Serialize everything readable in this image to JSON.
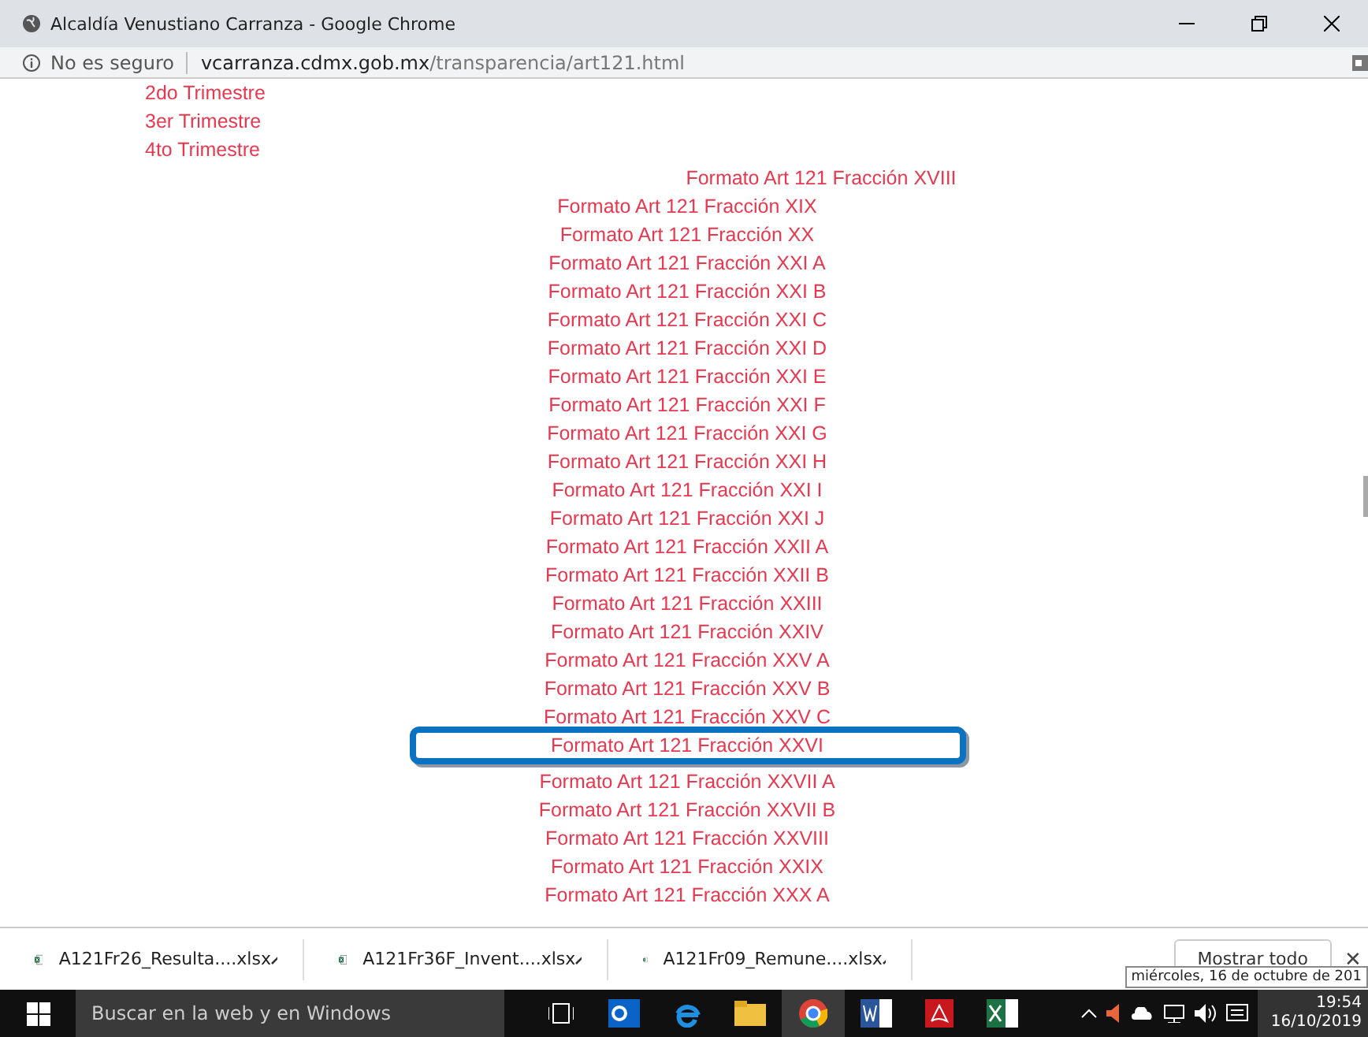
{
  "window": {
    "title": "Alcaldía Venustiano Carranza - Google Chrome"
  },
  "address_bar": {
    "security": "No es seguro",
    "host": "vcarranza.cdmx.gob.mx",
    "path": "/transparencia/art121.html"
  },
  "trimestres": [
    {
      "label": "2do Trimestre"
    },
    {
      "label": "3er Trimestre"
    },
    {
      "label": "4to Trimestre"
    }
  ],
  "links": [
    {
      "label": "Formato Art 121 Fracción XVIII",
      "highlighted": false
    },
    {
      "label": "Formato Art 121 Fracción XIX",
      "highlighted": false
    },
    {
      "label": "Formato Art 121 Fracción XX",
      "highlighted": false
    },
    {
      "label": "Formato Art 121 Fracción XXI A",
      "highlighted": false
    },
    {
      "label": "Formato Art 121 Fracción XXI B",
      "highlighted": false
    },
    {
      "label": "Formato Art 121 Fracción XXI C",
      "highlighted": false
    },
    {
      "label": "Formato Art 121 Fracción XXI D",
      "highlighted": false
    },
    {
      "label": "Formato Art 121 Fracción XXI E",
      "highlighted": false
    },
    {
      "label": "Formato Art 121 Fracción XXI F",
      "highlighted": false
    },
    {
      "label": "Formato Art 121 Fracción XXI G",
      "highlighted": false
    },
    {
      "label": "Formato Art 121 Fracción XXI H",
      "highlighted": false
    },
    {
      "label": "Formato Art 121 Fracción XXI I",
      "highlighted": false
    },
    {
      "label": "Formato Art 121 Fracción XXI J",
      "highlighted": false
    },
    {
      "label": "Formato Art 121 Fracción XXII A",
      "highlighted": false
    },
    {
      "label": "Formato Art 121 Fracción XXII B",
      "highlighted": false
    },
    {
      "label": "Formato Art 121 Fracción XXIII",
      "highlighted": false
    },
    {
      "label": "Formato Art 121 Fracción XXIV",
      "highlighted": false
    },
    {
      "label": "Formato Art 121 Fracción XXV A",
      "highlighted": false
    },
    {
      "label": "Formato Art 121 Fracción XXV B",
      "highlighted": false
    },
    {
      "label": "Formato Art 121 Fracción XXV C",
      "highlighted": false
    },
    {
      "label": "Formato Art 121 Fracción XXVI",
      "highlighted": true
    },
    {
      "label": "Formato Art 121 Fracción XXVII A",
      "highlighted": false
    },
    {
      "label": "Formato Art 121 Fracción XXVII B",
      "highlighted": false
    },
    {
      "label": "Formato Art 121 Fracción XXVIII",
      "highlighted": false
    },
    {
      "label": "Formato Art 121 Fracción XXIX",
      "highlighted": false
    },
    {
      "label": "Formato Art 121 Fracción XXX A",
      "highlighted": false
    }
  ],
  "downloads": [
    {
      "name": "A121Fr26_Resulta....xlsx"
    },
    {
      "name": "A121Fr36F_Invent....xlsx"
    },
    {
      "name": "A121Fr09_Remune....xlsx"
    }
  ],
  "download_bar": {
    "show_all": "Mostrar todo",
    "close": "✕"
  },
  "taskbar": {
    "search_placeholder": "Buscar en la web y en Windows",
    "time": "19:54",
    "date": "16/10/2019",
    "tooltip": "miércoles, 16 de octubre de 201"
  }
}
